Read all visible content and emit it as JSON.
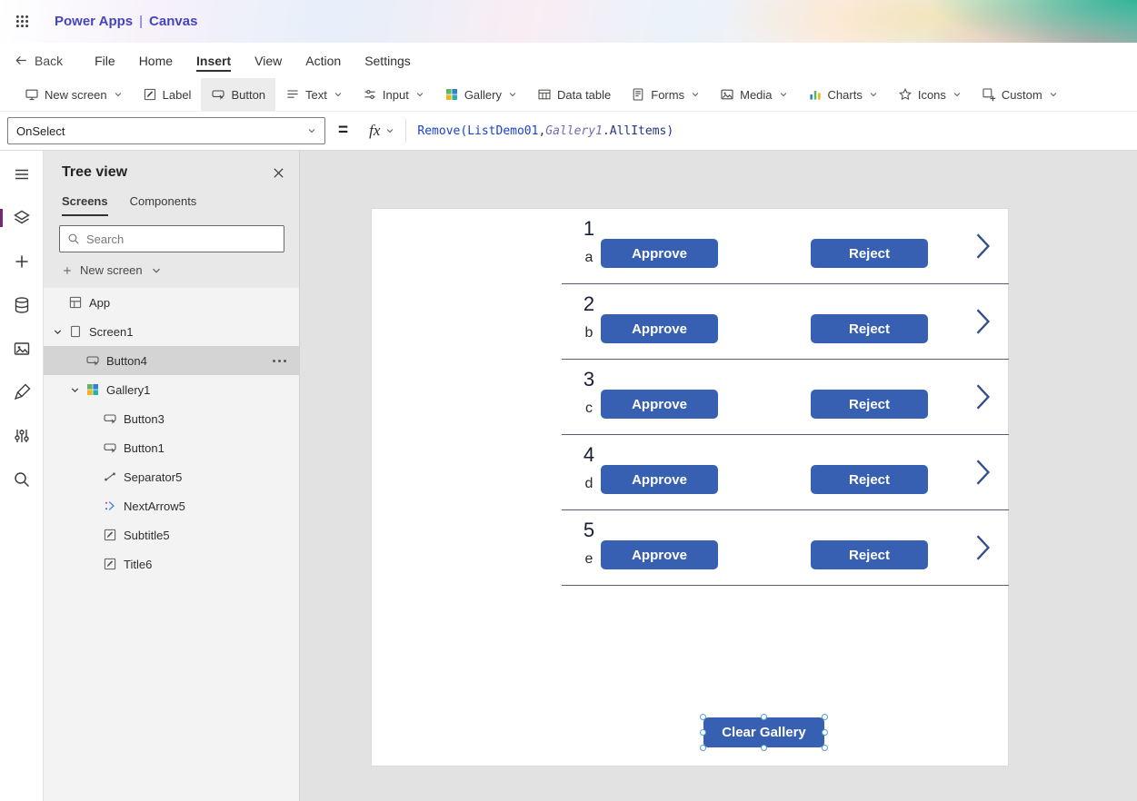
{
  "header": {
    "brand": "Power Apps",
    "separator": "|",
    "app_name": "Canvas"
  },
  "menu": {
    "back_label": "Back",
    "items": [
      {
        "label": "File",
        "active": false
      },
      {
        "label": "Home",
        "active": false
      },
      {
        "label": "Insert",
        "active": true
      },
      {
        "label": "View",
        "active": false
      },
      {
        "label": "Action",
        "active": false
      },
      {
        "label": "Settings",
        "active": false
      }
    ]
  },
  "toolbar": {
    "items": [
      {
        "label": "New screen",
        "icon": "new-screen-icon",
        "dropdown": true,
        "active": false
      },
      {
        "label": "Label",
        "icon": "label-control-icon",
        "dropdown": false,
        "active": false
      },
      {
        "label": "Button",
        "icon": "button-control-icon",
        "dropdown": false,
        "active": true
      },
      {
        "label": "Text",
        "icon": "text-icon",
        "dropdown": true,
        "active": false
      },
      {
        "label": "Input",
        "icon": "input-icon",
        "dropdown": true,
        "active": false
      },
      {
        "label": "Gallery",
        "icon": "gallery-control-icon",
        "dropdown": true,
        "active": false
      },
      {
        "label": "Data table",
        "icon": "data-table-icon",
        "dropdown": false,
        "active": false
      },
      {
        "label": "Forms",
        "icon": "forms-icon",
        "dropdown": true,
        "active": false
      },
      {
        "label": "Media",
        "icon": "media-icon",
        "dropdown": true,
        "active": false
      },
      {
        "label": "Charts",
        "icon": "charts-icon",
        "dropdown": true,
        "active": false
      },
      {
        "label": "Icons",
        "icon": "icons-icon",
        "dropdown": true,
        "active": false
      },
      {
        "label": "Custom",
        "icon": "custom-icon",
        "dropdown": true,
        "active": false
      }
    ]
  },
  "formula_bar": {
    "property": "OnSelect",
    "equals": "=",
    "fx_label": "fx",
    "tokens": [
      {
        "text": "Remove(",
        "style": "function"
      },
      {
        "text": "ListDemo01",
        "style": "function"
      },
      {
        "text": ",",
        "style": "plain"
      },
      {
        "text": "Gallery1",
        "style": "entity"
      },
      {
        "text": ".AllItems)",
        "style": "member"
      }
    ]
  },
  "rail": {
    "items": [
      {
        "icon": "menu-icon",
        "selected": false
      },
      {
        "icon": "tree-view-icon",
        "selected": true
      },
      {
        "icon": "insert-icon",
        "selected": false
      },
      {
        "icon": "data-icon",
        "selected": false
      },
      {
        "icon": "media-icon",
        "selected": false
      },
      {
        "icon": "advanced-tools-icon",
        "selected": false
      },
      {
        "icon": "variables-icon",
        "selected": false
      },
      {
        "icon": "search-icon",
        "selected": false
      }
    ]
  },
  "tree_panel": {
    "title": "Tree view",
    "tabs": [
      {
        "label": "Screens",
        "active": true
      },
      {
        "label": "Components",
        "active": false
      }
    ],
    "search_placeholder": "Search",
    "new_screen_label": "New screen",
    "items": [
      {
        "label": "App",
        "icon": "app-icon",
        "indent": 0,
        "caret": false,
        "selected": false,
        "more": false
      },
      {
        "label": "Screen1",
        "icon": "screen-icon",
        "indent": 0,
        "caret": true,
        "selected": false,
        "more": false
      },
      {
        "label": "Button4",
        "icon": "button-control-icon",
        "indent": 1,
        "caret": false,
        "selected": true,
        "more": true
      },
      {
        "label": "Gallery1",
        "icon": "gallery-control-icon",
        "indent": 1,
        "caret": true,
        "selected": false,
        "more": false
      },
      {
        "label": "Button3",
        "icon": "button-control-icon",
        "indent": 2,
        "caret": false,
        "selected": false,
        "more": false
      },
      {
        "label": "Button1",
        "icon": "button-control-icon",
        "indent": 2,
        "caret": false,
        "selected": false,
        "more": false
      },
      {
        "label": "Separator5",
        "icon": "separator-control-icon",
        "indent": 2,
        "caret": false,
        "selected": false,
        "more": false
      },
      {
        "label": "NextArrow5",
        "icon": "arrow-control-icon",
        "indent": 2,
        "caret": false,
        "selected": false,
        "more": false
      },
      {
        "label": "Subtitle5",
        "icon": "label-control-icon",
        "indent": 2,
        "caret": false,
        "selected": false,
        "more": false
      },
      {
        "label": "Title6",
        "icon": "label-control-icon",
        "indent": 2,
        "caret": false,
        "selected": false,
        "more": false
      }
    ]
  },
  "canvas": {
    "gallery_rows": [
      {
        "title": "1",
        "subtitle": "a",
        "approve_label": "Approve",
        "reject_label": "Reject"
      },
      {
        "title": "2",
        "subtitle": "b",
        "approve_label": "Approve",
        "reject_label": "Reject"
      },
      {
        "title": "3",
        "subtitle": "c",
        "approve_label": "Approve",
        "reject_label": "Reject"
      },
      {
        "title": "4",
        "subtitle": "d",
        "approve_label": "Approve",
        "reject_label": "Reject"
      },
      {
        "title": "5",
        "subtitle": "e",
        "approve_label": "Approve",
        "reject_label": "Reject"
      }
    ],
    "clear_button_label": "Clear Gallery"
  },
  "colors": {
    "button_blue": "#3860b2",
    "accent_purple": "#742774",
    "brand_text": "#4645bd",
    "row_separator": "#565b78",
    "handle_blue": "#52a2d8",
    "chevron_navy": "#33508c",
    "selected_row": "#d4d4d4"
  }
}
